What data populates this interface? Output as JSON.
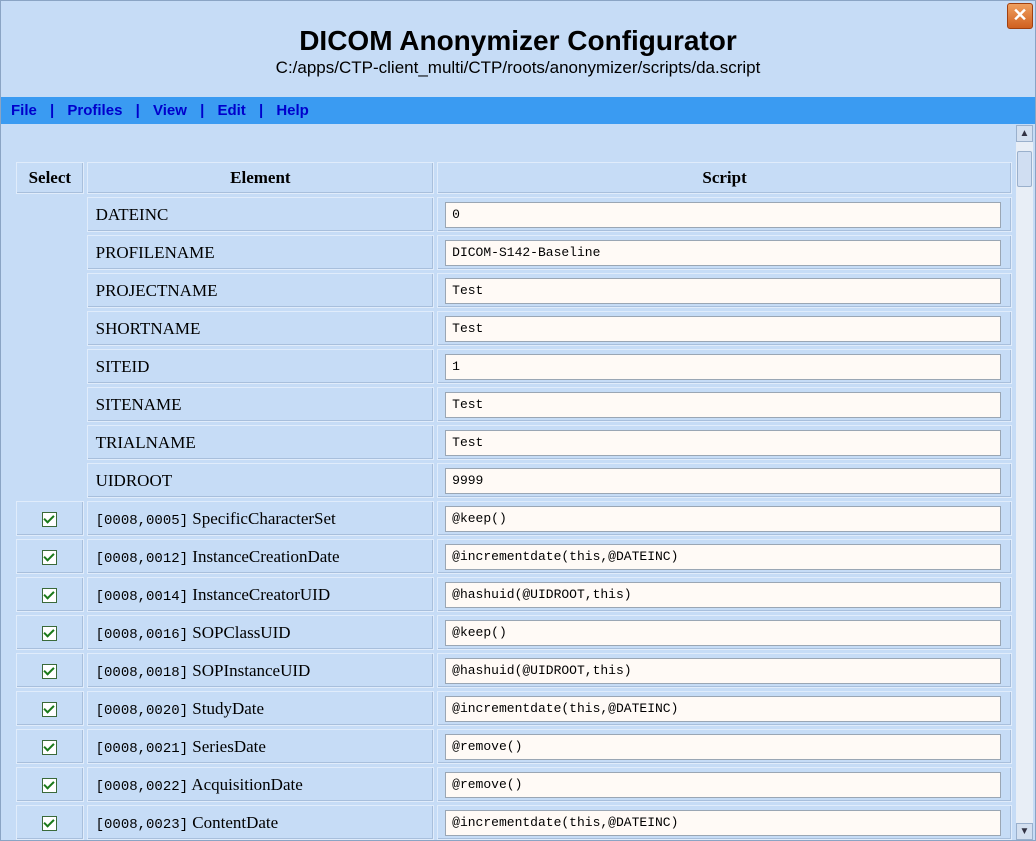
{
  "header": {
    "title": "DICOM Anonymizer Configurator",
    "path": "C:/apps/CTP-client_multi/CTP/roots/anonymizer/scripts/da.script",
    "close_glyph": "✕"
  },
  "menu": {
    "file": "File",
    "profiles": "Profiles",
    "view": "View",
    "edit": "Edit",
    "help": "Help",
    "separator": "|"
  },
  "table": {
    "col_select": "Select",
    "col_element": "Element",
    "col_script": "Script"
  },
  "params": [
    {
      "name": "DATEINC",
      "value": "0"
    },
    {
      "name": "PROFILENAME",
      "value": "DICOM-S142-Baseline"
    },
    {
      "name": "PROJECTNAME",
      "value": "Test"
    },
    {
      "name": "SHORTNAME",
      "value": "Test"
    },
    {
      "name": "SITEID",
      "value": "1"
    },
    {
      "name": "SITENAME",
      "value": "Test"
    },
    {
      "name": "TRIALNAME",
      "value": "Test"
    },
    {
      "name": "UIDROOT",
      "value": "9999"
    }
  ],
  "elements": [
    {
      "checked": true,
      "tag": "[0008,0005]",
      "name": "SpecificCharacterSet",
      "script": "@keep()"
    },
    {
      "checked": true,
      "tag": "[0008,0012]",
      "name": "InstanceCreationDate",
      "script": "@incrementdate(this,@DATEINC)"
    },
    {
      "checked": true,
      "tag": "[0008,0014]",
      "name": "InstanceCreatorUID",
      "script": "@hashuid(@UIDROOT,this)"
    },
    {
      "checked": true,
      "tag": "[0008,0016]",
      "name": "SOPClassUID",
      "script": "@keep()"
    },
    {
      "checked": true,
      "tag": "[0008,0018]",
      "name": "SOPInstanceUID",
      "script": "@hashuid(@UIDROOT,this)"
    },
    {
      "checked": true,
      "tag": "[0008,0020]",
      "name": "StudyDate",
      "script": "@incrementdate(this,@DATEINC)"
    },
    {
      "checked": true,
      "tag": "[0008,0021]",
      "name": "SeriesDate",
      "script": "@remove()"
    },
    {
      "checked": true,
      "tag": "[0008,0022]",
      "name": "AcquisitionDate",
      "script": "@remove()"
    },
    {
      "checked": true,
      "tag": "[0008,0023]",
      "name": "ContentDate",
      "script": "@incrementdate(this,@DATEINC)"
    }
  ],
  "colors": {
    "background": "#c6dcf6",
    "menubar": "#3a9bf2",
    "menu_text": "#0000cc",
    "input_bg": "#fffaf6"
  },
  "scrollbar": {
    "up_glyph": "▲",
    "down_glyph": "▼"
  }
}
